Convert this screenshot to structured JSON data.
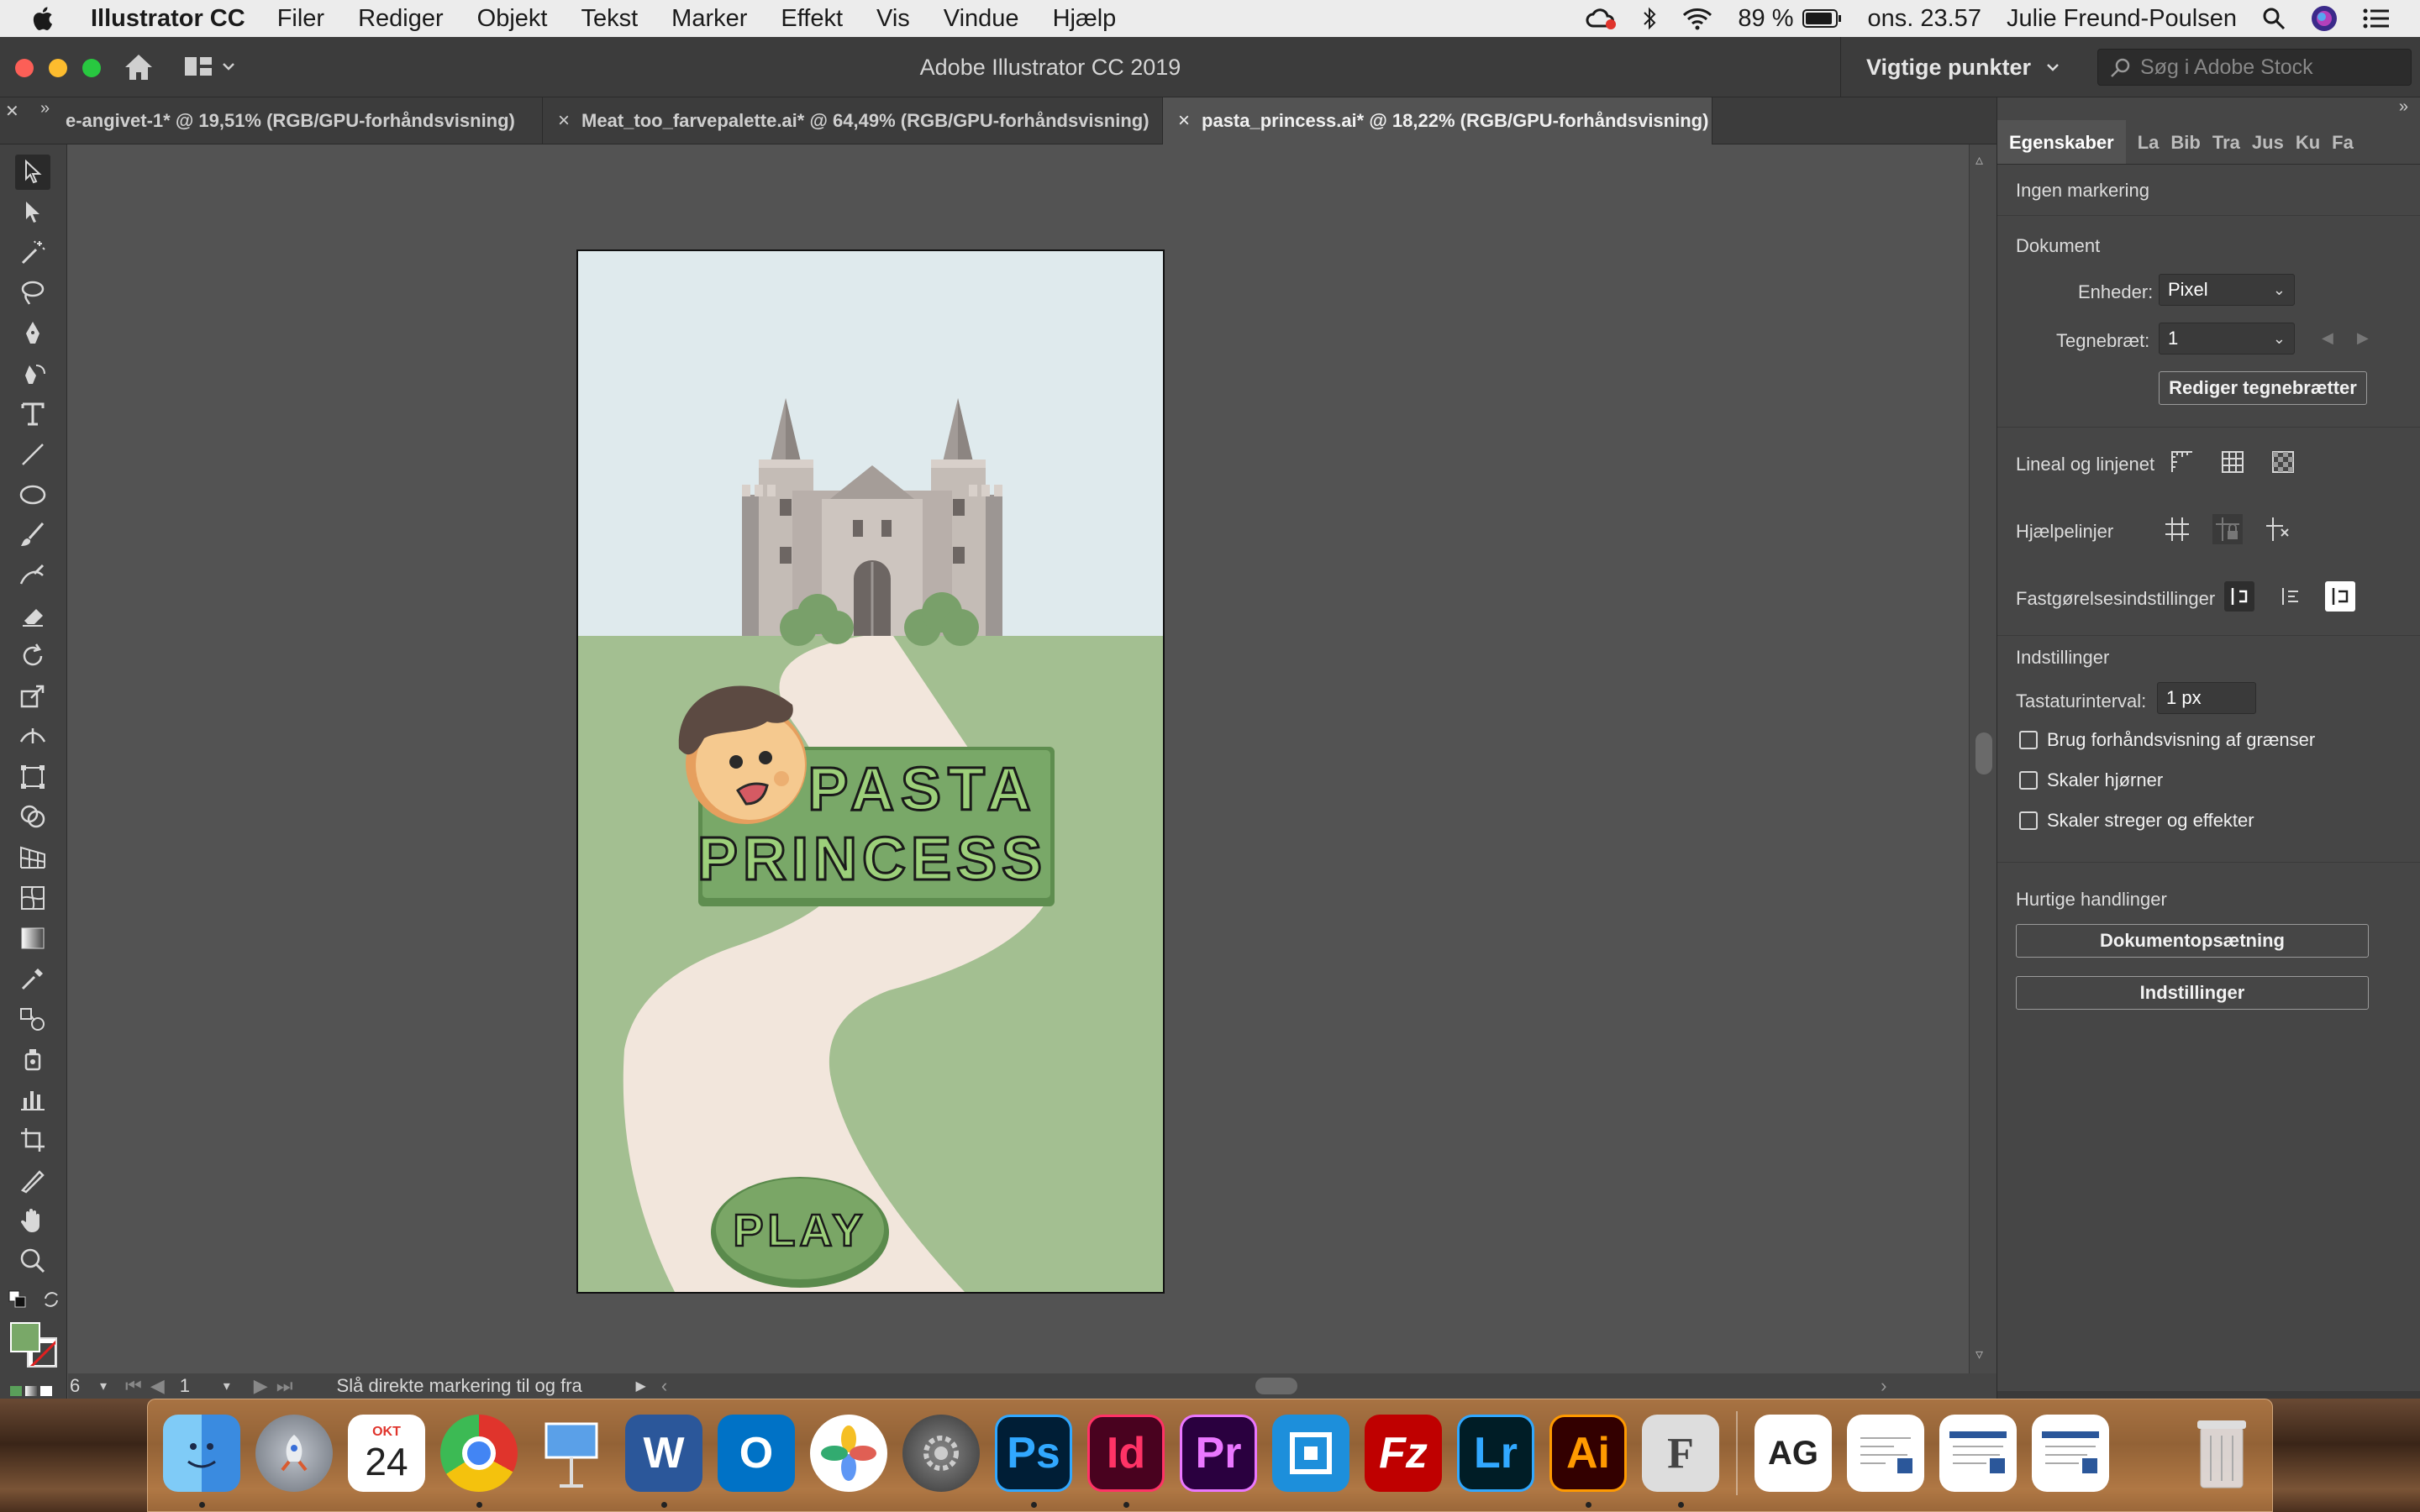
{
  "menubar": {
    "app_name": "Illustrator CC",
    "menus": [
      "Filer",
      "Rediger",
      "Objekt",
      "Tekst",
      "Marker",
      "Effekt",
      "Vis",
      "Vindue",
      "Hjælp"
    ],
    "battery": "89 %",
    "clock": "ons. 23.57",
    "user": "Julie Freund-Poulsen"
  },
  "appbar": {
    "title": "Adobe Illustrator CC 2019",
    "workspace": "Vigtige punkter",
    "stock_placeholder": "Søg i Adobe Stock"
  },
  "tabs": [
    {
      "label": "e-angivet-1* @ 19,51% (RGB/GPU-forhåndsvisning)"
    },
    {
      "label": "Meat_too_farvepalette.ai* @ 64,49% (RGB/GPU-forhåndsvisning)"
    },
    {
      "label": "pasta_princess.ai* @ 18,22% (RGB/GPU-forhåndsvisning)"
    }
  ],
  "artwork": {
    "title_line1": "PASTA",
    "title_line2": "PRINCESS",
    "play": "PLAY",
    "colors": {
      "sky": "#dfeaed",
      "grass": "#a3bf91",
      "path": "#f2e6dc",
      "sign": "#79a868",
      "button": "#7aa666"
    }
  },
  "status": {
    "zoom": "6",
    "page": "1",
    "message": "Slå direkte markering til og fra"
  },
  "panel": {
    "tabs": [
      "Egenskaber",
      "La",
      "Bib",
      "Tra",
      "Jus",
      "Ku",
      "Fa"
    ],
    "no_selection": "Ingen markering",
    "document_heading": "Dokument",
    "units_label": "Enheder:",
    "units_value": "Pixel",
    "artboard_label": "Tegnebræt:",
    "artboard_value": "1",
    "edit_artboards": "Rediger tegnebrætter",
    "rulers_label": "Lineal og linjenet",
    "guides_label": "Hjælpelinjer",
    "snap_label": "Fastgørelsesindstillinger",
    "prefs_heading": "Indstillinger",
    "keyboard_label": "Tastaturinterval:",
    "keyboard_value": "1 px",
    "cb_preview": "Brug forhåndsvisning af grænser",
    "cb_corners": "Skaler hjørner",
    "cb_strokes": "Skaler streger og effekter",
    "quick_heading": "Hurtige handlinger",
    "doc_setup": "Dokumentopsætning",
    "preferences": "Indstillinger"
  },
  "dock": {
    "calendar_month": "OKT",
    "calendar_day": "24",
    "apps": [
      "Finder",
      "Launchpad",
      "Kalender",
      "Chrome",
      "Keynote",
      "Word",
      "Outlook",
      "Fotos",
      "Systemindstillinger",
      "Ps",
      "Id",
      "Pr",
      "Spil",
      "FileZilla",
      "Lr",
      "Ai",
      "Font",
      "AG",
      "Dokument1",
      "Dokument2",
      "Dokument3",
      "Papirkurv"
    ]
  }
}
